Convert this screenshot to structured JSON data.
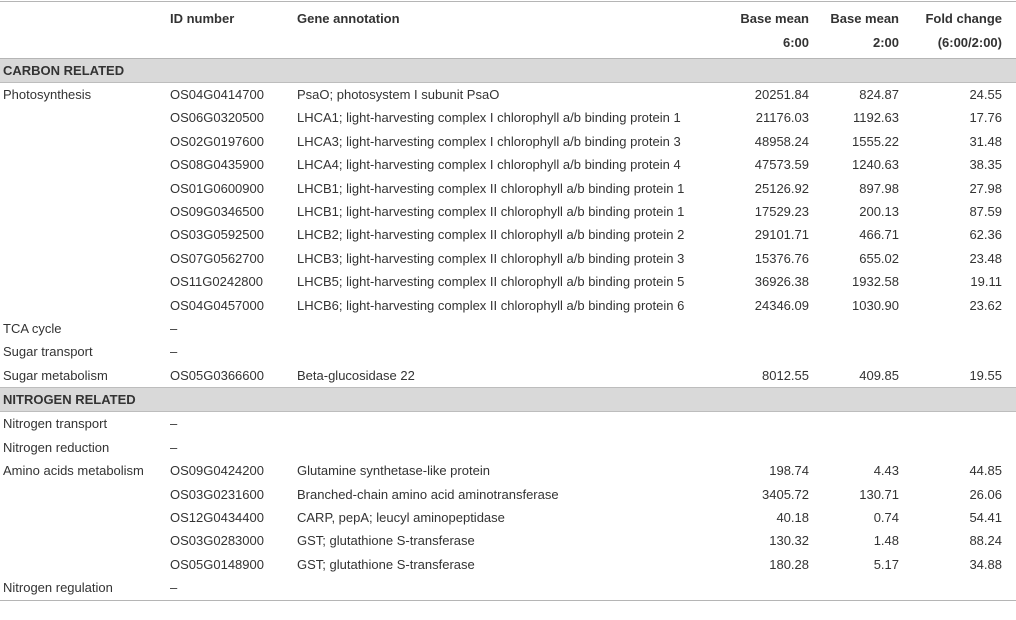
{
  "header": {
    "col1": "",
    "col2": "ID number",
    "col3": "Gene annotation",
    "col4_line1": "Base mean",
    "col4_line2": "6:00",
    "col5_line1": "Base mean",
    "col5_line2": "2:00",
    "col6_line1": "Fold change",
    "col6_line2": "(6:00/2:00)"
  },
  "sections": [
    {
      "title": "CARBON RELATED",
      "rows": [
        {
          "category": "Photosynthesis",
          "id": "OS04G0414700",
          "annotation": "PsaO; photosystem I subunit PsaO",
          "base6": "20251.84",
          "base2": "824.87",
          "fold": "24.55"
        },
        {
          "category": "",
          "id": "OS06G0320500",
          "annotation": "LHCA1; light-harvesting complex I chlorophyll a/b binding protein 1",
          "base6": "21176.03",
          "base2": "1192.63",
          "fold": "17.76"
        },
        {
          "category": "",
          "id": "OS02G0197600",
          "annotation": "LHCA3; light-harvesting complex I chlorophyll a/b binding protein 3",
          "base6": "48958.24",
          "base2": "1555.22",
          "fold": "31.48"
        },
        {
          "category": "",
          "id": "OS08G0435900",
          "annotation": "LHCA4; light-harvesting complex I chlorophyll a/b binding protein 4",
          "base6": "47573.59",
          "base2": "1240.63",
          "fold": "38.35"
        },
        {
          "category": "",
          "id": "OS01G0600900",
          "annotation": "LHCB1; light-harvesting complex II chlorophyll a/b binding protein 1",
          "base6": "25126.92",
          "base2": "897.98",
          "fold": "27.98"
        },
        {
          "category": "",
          "id": "OS09G0346500",
          "annotation": "LHCB1; light-harvesting complex II chlorophyll a/b binding protein 1",
          "base6": "17529.23",
          "base2": "200.13",
          "fold": "87.59"
        },
        {
          "category": "",
          "id": "OS03G0592500",
          "annotation": "LHCB2; light-harvesting complex II chlorophyll a/b binding protein 2",
          "base6": "29101.71",
          "base2": "466.71",
          "fold": "62.36"
        },
        {
          "category": "",
          "id": "OS07G0562700",
          "annotation": "LHCB3; light-harvesting complex II chlorophyll a/b binding protein 3",
          "base6": "15376.76",
          "base2": "655.02",
          "fold": "23.48"
        },
        {
          "category": "",
          "id": "OS11G0242800",
          "annotation": "LHCB5; light-harvesting complex II chlorophyll a/b binding protein 5",
          "base6": "36926.38",
          "base2": "1932.58",
          "fold": "19.11"
        },
        {
          "category": "",
          "id": "OS04G0457000",
          "annotation": "LHCB6; light-harvesting complex II chlorophyll a/b binding protein 6",
          "base6": "24346.09",
          "base2": "1030.90",
          "fold": "23.62"
        },
        {
          "category": "TCA cycle",
          "id": "–",
          "annotation": "",
          "base6": "",
          "base2": "",
          "fold": ""
        },
        {
          "category": "Sugar transport",
          "id": "–",
          "annotation": "",
          "base6": "",
          "base2": "",
          "fold": ""
        },
        {
          "category": "Sugar metabolism",
          "id": "OS05G0366600",
          "annotation": "Beta-glucosidase 22",
          "base6": "8012.55",
          "base2": "409.85",
          "fold": "19.55"
        }
      ]
    },
    {
      "title": "NITROGEN RELATED",
      "rows": [
        {
          "category": "Nitrogen transport",
          "id": "–",
          "annotation": "",
          "base6": "",
          "base2": "",
          "fold": ""
        },
        {
          "category": "Nitrogen reduction",
          "id": "–",
          "annotation": "",
          "base6": "",
          "base2": "",
          "fold": ""
        },
        {
          "category": "Amino acids metabolism",
          "id": "OS09G0424200",
          "annotation": "Glutamine synthetase-like protein",
          "base6": "198.74",
          "base2": "4.43",
          "fold": "44.85"
        },
        {
          "category": "",
          "id": "OS03G0231600",
          "annotation": "Branched-chain amino acid aminotransferase",
          "base6": "3405.72",
          "base2": "130.71",
          "fold": "26.06"
        },
        {
          "category": "",
          "id": "OS12G0434400",
          "annotation": "CARP, pepA; leucyl aminopeptidase",
          "base6": "40.18",
          "base2": "0.74",
          "fold": "54.41"
        },
        {
          "category": "",
          "id": "OS03G0283000",
          "annotation": "GST; glutathione S-transferase",
          "base6": "130.32",
          "base2": "1.48",
          "fold": "88.24"
        },
        {
          "category": "",
          "id": "OS05G0148900",
          "annotation": "GST; glutathione S-transferase",
          "base6": "180.28",
          "base2": "5.17",
          "fold": "34.88"
        },
        {
          "category": "Nitrogen regulation",
          "id": "–",
          "annotation": "",
          "base6": "",
          "base2": "",
          "fold": ""
        }
      ]
    }
  ],
  "colors": {
    "text": "#333333",
    "section_bg": "#d9d9d9",
    "rule": "#b5b5b5"
  }
}
